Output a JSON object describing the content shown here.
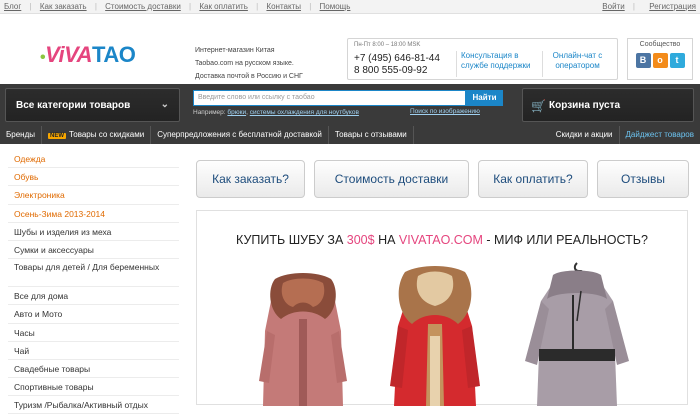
{
  "topbar": {
    "left": [
      "Блог",
      "Как заказать",
      "Стоимость доставки",
      "Как оплатить",
      "Контакты",
      "Помощь"
    ],
    "right": [
      "Войти",
      "Регистрация"
    ]
  },
  "logo": {
    "viva": "ViVA",
    "tao": "TAO"
  },
  "tagline": [
    "Интернет-магазин Китая",
    "Taobao.com на русском языке.",
    "Доставка почтой в Россию и СНГ"
  ],
  "contact": {
    "hours": "Пн-Пт 8:00 – 18:00 MSK",
    "phone1": "+7 (495) 646-81-44",
    "phone2": "8 800 555-09-92",
    "consult": "Консультация в службе поддержки",
    "chat": "Онлайн-чат с оператором"
  },
  "social": {
    "label": "Сообщество",
    "icons": [
      "vk-icon",
      "odnoklassniki-icon",
      "twitter-icon"
    ]
  },
  "nav": {
    "categories_label": "Все категории товаров",
    "search_placeholder": "Введите слово или ссылку с таобао",
    "search_button": "Найти",
    "hint_prefix": "Например:",
    "hint_link1": "брюки",
    "hint_link2": "системы охлаждения для ноутбуков",
    "image_search": "Поиск по изображению",
    "cart": "Корзина пуста"
  },
  "subnav": {
    "items": [
      "Бренды",
      "Товары со скидками",
      "Суперпредложения с бесплатной доставкой",
      "Товары с отзывами",
      "Скидки и акции",
      "Дайджест товаров"
    ],
    "new_badge": "NEW"
  },
  "sidebar": {
    "categories": [
      "Одежда",
      "Обувь",
      "Электроника",
      "Осень-Зима 2013-2014",
      "Шубы и изделия из меха",
      "Сумки и аксессуары",
      "Товары для детей / Для беременных",
      "Все для дома",
      "Авто и Мото",
      "Часы",
      "Чай",
      "Свадебные товары",
      "Спортивные товары",
      "Туризм /Рыбалка/Активный отдых"
    ]
  },
  "tabs": [
    "Как заказать?",
    "Стоимость доставки",
    "Как оплатить?",
    "Отзывы"
  ],
  "banner": {
    "prefix": "КУПИТЬ ШУБУ ЗА ",
    "price": "300$",
    "middle": " НА ",
    "site": "VIVATAO.COM",
    "suffix": " - МИФ ИЛИ РЕАЛЬНОСТЬ?"
  },
  "colors": {
    "accent": "#1b86c8",
    "brand_pink": "#e5457e",
    "highlight_orange": "#e06a00",
    "nav_dark": "#3a3a3a"
  }
}
